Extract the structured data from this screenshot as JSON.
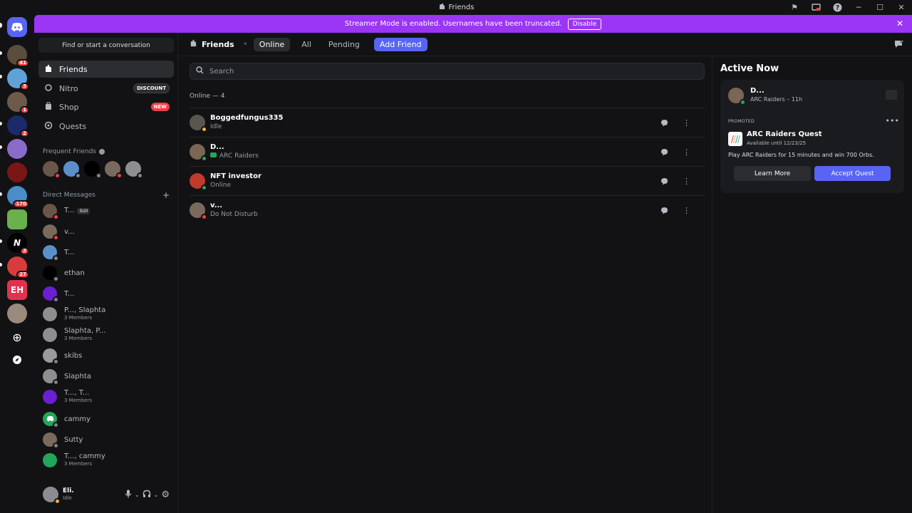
{
  "window": {
    "title": "Friends"
  },
  "banner": {
    "text": "Streamer Mode is enabled. Usernames have been truncated.",
    "disable_label": "Disable"
  },
  "rail": {
    "badges": [
      "41",
      "3",
      "1",
      "2",
      "",
      "",
      "170",
      "",
      "3",
      "27",
      "",
      ""
    ]
  },
  "sidebar": {
    "search_label": "Find or start a conversation",
    "nav": [
      {
        "label": "Friends",
        "tag": ""
      },
      {
        "label": "Nitro",
        "tag": "DISCOUNT"
      },
      {
        "label": "Shop",
        "tag": "NEW"
      },
      {
        "label": "Quests",
        "tag": ""
      }
    ],
    "frequent_friends_label": "Frequent Friends",
    "direct_messages_label": "Direct Messages",
    "dms": [
      {
        "name": "T...",
        "sub": "",
        "chip": "SUII"
      },
      {
        "name": "v...",
        "sub": ""
      },
      {
        "name": "T...",
        "sub": ""
      },
      {
        "name": "ethan",
        "sub": ""
      },
      {
        "name": "T...",
        "sub": ""
      },
      {
        "name": "P..., Slaphta",
        "sub": "3 Members"
      },
      {
        "name": "Slaphta, P...",
        "sub": "3 Members"
      },
      {
        "name": "skibs",
        "sub": ""
      },
      {
        "name": "Slaphta",
        "sub": ""
      },
      {
        "name": "T..., T...",
        "sub": "3 Members"
      },
      {
        "name": "cammy",
        "sub": ""
      },
      {
        "name": "Sutty",
        "sub": ""
      },
      {
        "name": "T..., cammy",
        "sub": "3 Members"
      }
    ],
    "user": {
      "name": "Eli.",
      "status": "Idle"
    }
  },
  "topbar": {
    "title": "Friends",
    "tabs": [
      "Online",
      "All",
      "Pending"
    ],
    "add_friend": "Add Friend"
  },
  "friends": {
    "search_placeholder": "Search",
    "online_count": "Online — 4",
    "rows": [
      {
        "name": "Boggedfungus335",
        "status": "Idle"
      },
      {
        "name": "D...",
        "status": "ARC Raiders"
      },
      {
        "name": "NFT investor",
        "status": "Online"
      },
      {
        "name": "v...",
        "status": "Do Not Disturb"
      }
    ]
  },
  "active_now": {
    "title": "Active Now",
    "user": {
      "name": "D...",
      "status": "ARC Raiders – 11h"
    },
    "promoted_label": "PROMOTED",
    "quest_name": "ARC Raiders Quest",
    "quest_sub": "Available until 12/23/25",
    "quest_desc": "Play ARC Raiders for 15 minutes and win 700 Orbs.",
    "learn_more": "Learn More",
    "accept_quest": "Accept Quest"
  },
  "colors": {
    "accent": "#5865f2",
    "banner": "#9b36f4",
    "online": "#23a55a",
    "idle": "#f0b232",
    "dnd": "#f23f42"
  }
}
